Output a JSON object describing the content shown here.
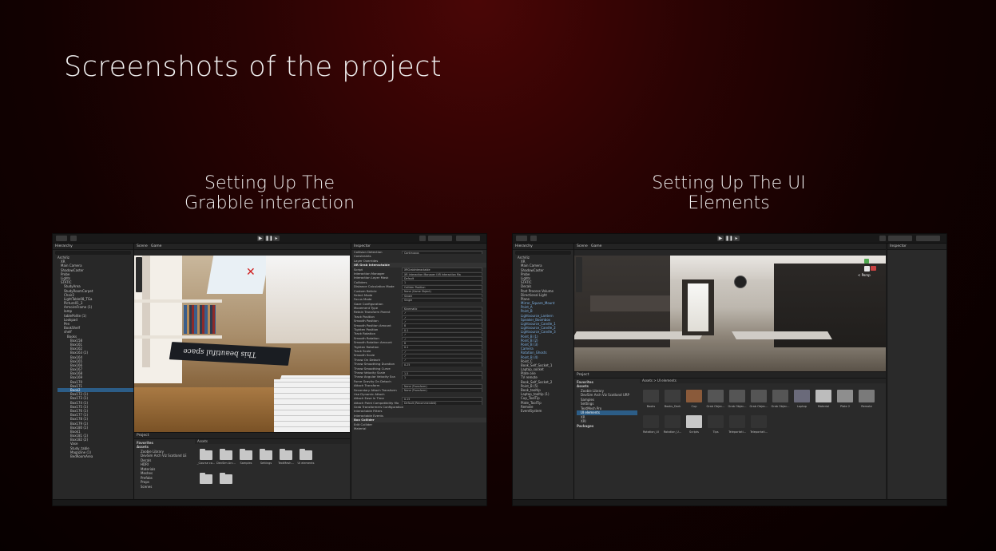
{
  "slide": {
    "title": "Screenshots of the project",
    "left_caption": "Setting Up The\nGrabble interaction",
    "right_caption": "Setting Up The UI\nElements"
  },
  "left_shot": {
    "hierarchy_title": "Hierarchy",
    "hierarchy": [
      "ArchViz",
      "XR",
      "Main Camera",
      "ShadowCaster",
      "Probe",
      "Lights",
      "STATIC",
      "StudyArea",
      "StudyRoomCarpet",
      "Chair2",
      "LightTable08_TGa",
      "Picture01_3",
      "ArmoireFrame (1)",
      "lamp",
      "tablePolite (1)",
      "Lookpad",
      "Pen",
      "BookShelf",
      "shelf",
      "Books",
      "Box158",
      "Box161",
      "Box162",
      "Box163 (1)",
      "Box164",
      "Box165",
      "Box166",
      "Box167",
      "Box168",
      "Box169",
      "Box170",
      "Box171",
      "Book2",
      "Box172 (1)",
      "Box173 (1)",
      "Box174 (1)",
      "Box175 (1)",
      "Box176 (1)",
      "Box177 (1)",
      "Box178 (1)",
      "Box179 (1)",
      "Box180 (1)",
      "Book1",
      "Box181 (1)",
      "Box182 (2)",
      "Vase",
      "Study_table",
      "Magazine (1)",
      "BedRoomArea"
    ],
    "hierarchy_selected": "Book2",
    "scene_tabs": [
      "Scene",
      "Game"
    ],
    "book_text": "This beautiful space",
    "inspector_title": "Inspector",
    "inspector_rows": [
      {
        "label": "Collision Detection",
        "value": "Continuous"
      },
      {
        "label": "Constraints",
        "value": ""
      },
      {
        "label": "Layer Overrides",
        "value": ""
      },
      {
        "label": "XR Grab Interactable",
        "value": "",
        "header": true
      },
      {
        "label": "Script",
        "value": "XRGrabInteractable"
      },
      {
        "label": "Interaction Manager",
        "value": "XR Interaction Manager (XR Interaction Ma"
      },
      {
        "label": "Interaction Layer Mask",
        "value": "Default"
      },
      {
        "label": "Colliders",
        "value": "1"
      },
      {
        "label": "Distance Calculation Mode",
        "value": "Collider Position"
      },
      {
        "label": "Custom Reticle",
        "value": "None (Game Object)"
      },
      {
        "label": "Select Mode",
        "value": "Single"
      },
      {
        "label": "Focus Mode",
        "value": "Single"
      },
      {
        "label": "Gaze Configuration",
        "value": ""
      },
      {
        "label": "Movement Type",
        "value": "Kinematic"
      },
      {
        "label": "Retain Transform Parent",
        "value": "✓"
      },
      {
        "label": "Track Position",
        "value": "✓"
      },
      {
        "label": "Smooth Position",
        "value": "✓"
      },
      {
        "label": "Smooth Position Amount",
        "value": "8"
      },
      {
        "label": "Tighten Position",
        "value": "0.1"
      },
      {
        "label": "Track Rotation",
        "value": "✓"
      },
      {
        "label": "Smooth Rotation",
        "value": "✓"
      },
      {
        "label": "Smooth Rotation Amount",
        "value": "8"
      },
      {
        "label": "Tighten Rotation",
        "value": "0.1"
      },
      {
        "label": "Track Scale",
        "value": "✓"
      },
      {
        "label": "Smooth Scale",
        "value": "✓"
      },
      {
        "label": "Throw On Detach",
        "value": "✓"
      },
      {
        "label": "Throw Smoothing Duration",
        "value": "0.25"
      },
      {
        "label": "Throw Smoothing Curve",
        "value": ""
      },
      {
        "label": "Throw Velocity Scale",
        "value": "1.5"
      },
      {
        "label": "Throw Angular Velocity Sca",
        "value": "1"
      },
      {
        "label": "Force Gravity On Detach",
        "value": ""
      },
      {
        "label": "Attach Transform",
        "value": "None (Transform)"
      },
      {
        "label": "Secondary Attach Transform",
        "value": "None (Transform)"
      },
      {
        "label": "Use Dynamic Attach",
        "value": ""
      },
      {
        "label": "Attach Ease In Time",
        "value": "0.15"
      },
      {
        "label": "Attach Point Compatibility Mo",
        "value": "Default (Recommended)"
      },
      {
        "label": "Grab Transformers Configuration",
        "value": ""
      },
      {
        "label": "Interactable Filters",
        "value": ""
      },
      {
        "label": "Interactable Events",
        "value": ""
      },
      {
        "label": "Box Collider",
        "value": "",
        "header": true
      },
      {
        "label": "Edit Collider",
        "value": ""
      },
      {
        "label": "Material",
        "value": ""
      }
    ],
    "project_title": "Project",
    "project_tree": [
      "Favorites",
      "Assets",
      "Zoobie Library",
      "DevSim Arch Viz Scotland LE",
      "Decals",
      "HDRI",
      "Materials",
      "Meshes",
      "Prefabs",
      "Props",
      "Scenes"
    ],
    "assets_path": "Assets",
    "assets": [
      "_Course co...",
      "DevSim Arc...",
      "Samples",
      "Settings",
      "TextMesh...",
      "UI elements",
      "",
      ""
    ]
  },
  "right_shot": {
    "hierarchy_title": "Hierarchy",
    "hierarchy": [
      "ArchViz",
      "XR",
      "Main Camera",
      "ShadowCaster",
      "Probe",
      "Lights",
      "STATIC",
      "Decals",
      "Post Process Volume",
      "Directional Light",
      "Plane",
      "Mirror_Square_Mount",
      "Point_A",
      "Point_B",
      "Lightsource_Lantern",
      "Speaker_Boombox",
      "Lightsource_Candle_1",
      "Lightsource_Candle_2",
      "Lightsource_Candle_3",
      "Point_B (1)",
      "Point_B (2)",
      "Point_B (3)",
      "Camera",
      "Rotation_Ghosts",
      "Point_B (4)",
      "Point_C",
      "Book_Self_Socket_1",
      "Laptop_socket",
      "Plate one",
      "TV remote",
      "Book_Self_Socket_2",
      "Point_B (5)",
      "Book_tooltip",
      "Laptop_tooltip (1)",
      "Cup_ToolTip",
      "Plate_ToolTip",
      "Remote",
      "EventSystem"
    ],
    "scene_tabs": [
      "Scene",
      "Game"
    ],
    "gizmo_label": "< Persp",
    "inspector_title": "Inspector",
    "project_title": "Project",
    "project_tree": [
      "Favorites",
      "Assets",
      "Zoobie Library",
      "DevSim Arch Viz Scotland URP",
      "Samples",
      "Settings",
      "TextMesh Pro",
      "UI elements",
      "XR",
      "XRI",
      "Packages"
    ],
    "assets_path": "Assets > UI elements",
    "assets_row1": [
      "Books",
      "Books_Dark",
      "Cup",
      "Grab Objec...",
      "Grab Objec...",
      "Grab Objec...",
      "Grab Objec...",
      "Laptop",
      "Material",
      "Plate 2",
      "Remote"
    ],
    "assets_row2": [
      "Rotation_UI",
      "Rotation_U...",
      "Scripts",
      "Tips",
      "Teleportati...",
      "Teleportati..."
    ]
  },
  "colors": {
    "accent": "#2c5d87",
    "folder": "#c7c7c7",
    "editor_bg": "#282828"
  }
}
